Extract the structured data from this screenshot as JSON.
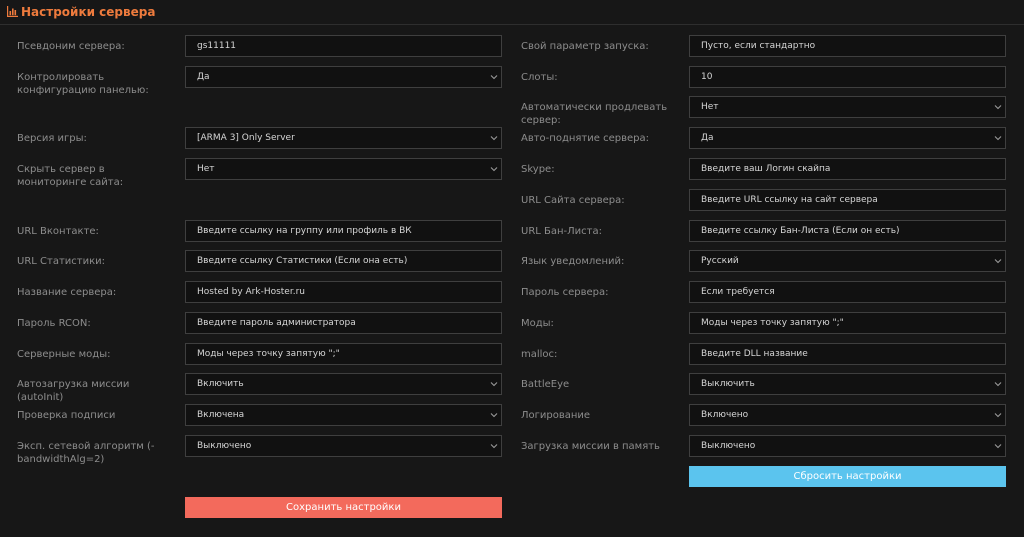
{
  "header": {
    "title": "Настройки сервера",
    "icon": "bar-chart-icon",
    "accent": "#ee7b3d"
  },
  "left": [
    {
      "name": "server-alias",
      "label": "Псевдоним сервера:",
      "type": "input",
      "value": "gs11111"
    },
    {
      "name": "panel-config",
      "label": "Контролировать конфигурацию панелью:",
      "type": "select",
      "value": "Да"
    },
    {
      "name": "game-version",
      "label": "Версия игры:",
      "type": "select",
      "value": "[ARMA 3] Only Server"
    },
    {
      "name": "hide-monitoring",
      "label": "Скрыть сервер в мониторинге сайта:",
      "type": "select",
      "value": "Нет"
    },
    {
      "name": "vk-url",
      "label": "URL Вконтакте:",
      "type": "input",
      "value": "Введите ссылку на группу или профиль в ВК"
    },
    {
      "name": "stats-url",
      "label": "URL Статистики:",
      "type": "input",
      "value": "Введите ссылку Статистики (Если она есть)"
    },
    {
      "name": "server-name",
      "label": "Название сервера:",
      "type": "input",
      "value": "Hosted by Ark-Hoster.ru"
    },
    {
      "name": "rcon-password",
      "label": "Пароль RCON:",
      "type": "input",
      "value": "Введите пароль администратора"
    },
    {
      "name": "server-mods",
      "label": "Серверные моды:",
      "type": "input",
      "value": "Моды через точку запятую \";\""
    },
    {
      "name": "autoinit",
      "label": "Автозагрузка миссии (autoInit)",
      "type": "select",
      "value": "Включить"
    },
    {
      "name": "signature-check",
      "label": "Проверка подписи",
      "type": "select",
      "value": "Включена"
    },
    {
      "name": "bandwidth-alg",
      "label": "Эксп. сетевой алгоритм (-bandwidthAlg=2)",
      "type": "select",
      "value": "Выключено"
    }
  ],
  "right": [
    {
      "name": "launch-param",
      "label": "Свой параметр запуска:",
      "type": "input",
      "value": "Пусто, если стандартно"
    },
    {
      "name": "slots",
      "label": "Слоты:",
      "type": "input",
      "value": "10"
    },
    {
      "name": "auto-renew",
      "label": "Автоматически продлевать сервер:",
      "type": "select",
      "value": "Нет"
    },
    {
      "name": "auto-start",
      "label": "Авто-поднятие сервера:",
      "type": "select",
      "value": "Да"
    },
    {
      "name": "skype",
      "label": "Skype:",
      "type": "input",
      "value": "Введите ваш Логин скайпа"
    },
    {
      "name": "site-url",
      "label": "URL Сайта сервера:",
      "type": "input",
      "value": "Введите URL ссылку на сайт сервера"
    },
    {
      "name": "banlist-url",
      "label": "URL Бан-Листа:",
      "type": "input",
      "value": "Введите ссылку Бан-Листа (Если он есть)"
    },
    {
      "name": "notify-lang",
      "label": "Язык уведомлений:",
      "type": "select",
      "value": "Русский"
    },
    {
      "name": "server-password",
      "label": "Пароль сервера:",
      "type": "input",
      "value": "Если требуется"
    },
    {
      "name": "mods",
      "label": "Моды:",
      "type": "input",
      "value": "Моды через точку запятую \";\""
    },
    {
      "name": "malloc",
      "label": "malloc:",
      "type": "input",
      "value": "Введите DLL название"
    },
    {
      "name": "battleye",
      "label": "BattleEye",
      "type": "select",
      "value": "Выключить"
    },
    {
      "name": "logging",
      "label": "Логирование",
      "type": "select",
      "value": "Включено"
    },
    {
      "name": "mission-memory",
      "label": "Загрузка миссии в память",
      "type": "select",
      "value": "Выключено"
    }
  ],
  "buttons": {
    "reset_label": "Сбросить настройки",
    "save_label": "Сохранить настройки",
    "reset_color": "#5bc4ee",
    "save_color": "#f36a5c"
  },
  "chevron_icon": "chevron-down-icon"
}
